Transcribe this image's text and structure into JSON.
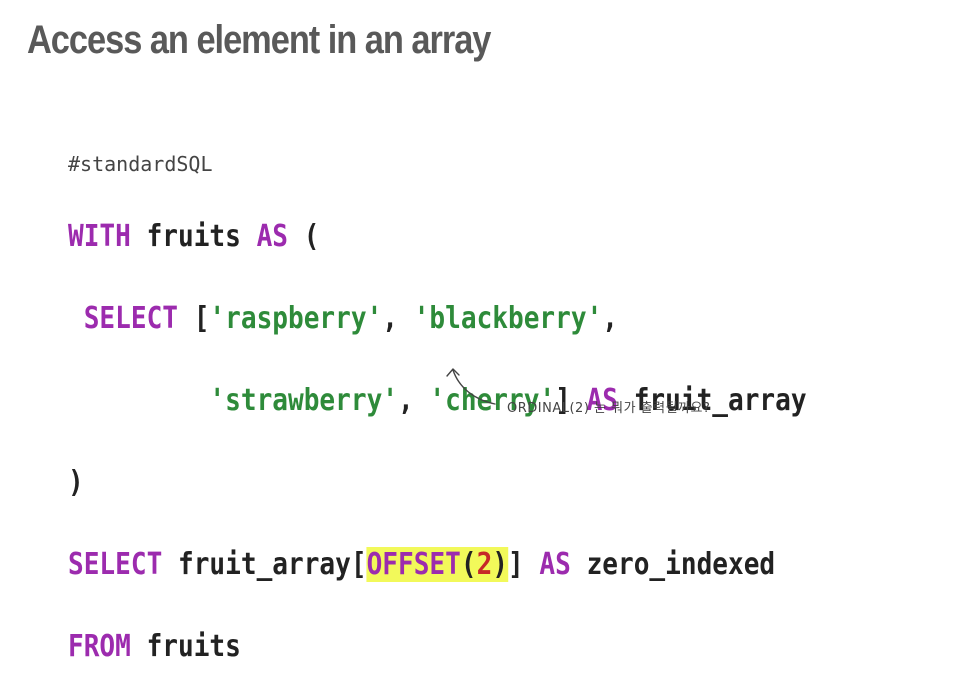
{
  "title": "Access an element in an array",
  "code": {
    "comment": "#standardSQL",
    "l1": {
      "kw1": "WITH",
      "id1": " fruits ",
      "kw2": "AS",
      "p1": " ("
    },
    "l2": {
      "kw1": " SELECT",
      "p1": " [",
      "s1": "'raspberry'",
      "p2": ", ",
      "s2": "'blackberry'",
      "p3": ","
    },
    "l3": {
      "pad": "         ",
      "s1": "'strawberry'",
      "p1": ", ",
      "s2": "'cherry'",
      "p2": "] ",
      "kw1": "AS",
      "id1": " fruit_array"
    },
    "l4": {
      "p1": ")"
    },
    "l5": {
      "kw1": "SELECT",
      "id1": " fruit_array[",
      "kw2": "OFFSET",
      "p1": "(",
      "n1": "2",
      "p2": ")",
      "p3": "] ",
      "kw3": "AS",
      "id2": " zero_indexed"
    },
    "l6": {
      "kw1": "FROM",
      "id1": " fruits"
    }
  },
  "annotation": "ORDINAL(2) 는 뭐가 출력될까요?"
}
